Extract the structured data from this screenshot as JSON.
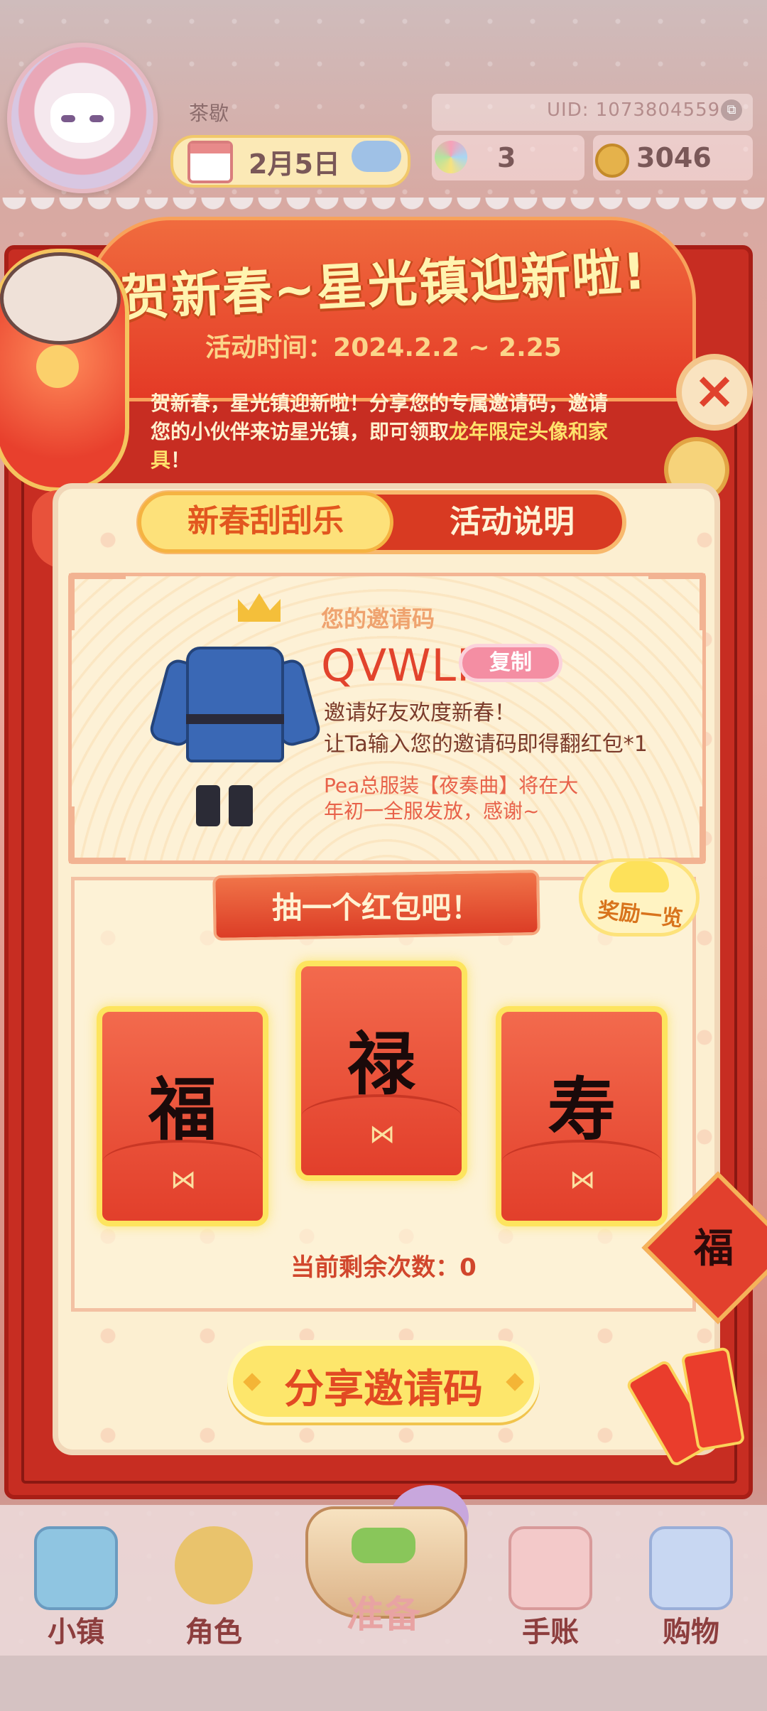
{
  "topbar": {
    "player_name": "茶歇",
    "uid": "UID: 1073804559",
    "date": "2月5日",
    "gems": "3",
    "coins": "3046"
  },
  "event": {
    "title": "贺新春~星光镇迎新啦!",
    "period": "活动时间：2024.2.2 ~ 2.25",
    "desc_part1": "贺新春，星光镇迎新啦！分享您的专属邀请码，邀请您的小伙伴来访星光镇，即可领取",
    "desc_highlight": "龙年限定头像和家具",
    "desc_part2": "！",
    "close": "×"
  },
  "tabs": {
    "scratch": "新春刮刮乐",
    "rules": "活动说明"
  },
  "invite": {
    "label": "您的邀请码",
    "code": "QVWLP",
    "copy_label": "复制",
    "line1": "邀请好友欢度新春！",
    "line2": "让Ta输入您的邀请码即得翻红包*1",
    "note1": "Pea总服装【夜奏曲】将在大",
    "note2": "年初一全服发放，感谢~"
  },
  "draw": {
    "title": "抽一个红包吧！",
    "reward_label": "奖励一览",
    "envelopes": [
      "福",
      "禄",
      "寿"
    ],
    "bow_glyph": "⋈",
    "remaining": "当前剩余次数：0"
  },
  "share": {
    "label": "分享邀请码"
  },
  "deco": {
    "knot_char": "福"
  },
  "nav": {
    "items": [
      {
        "label": "小镇",
        "icon": "map-icon"
      },
      {
        "label": "角色",
        "icon": "character-icon"
      },
      {
        "label": "准备",
        "icon": "basket-icon"
      },
      {
        "label": "手账",
        "icon": "journal-icon"
      },
      {
        "label": "购物",
        "icon": "shopping-bag-icon"
      }
    ]
  },
  "colors": {
    "frame_red": "#c72d22",
    "gold": "#fde45e",
    "panel": "#fcefd1",
    "accent_orange": "#e2432c"
  }
}
